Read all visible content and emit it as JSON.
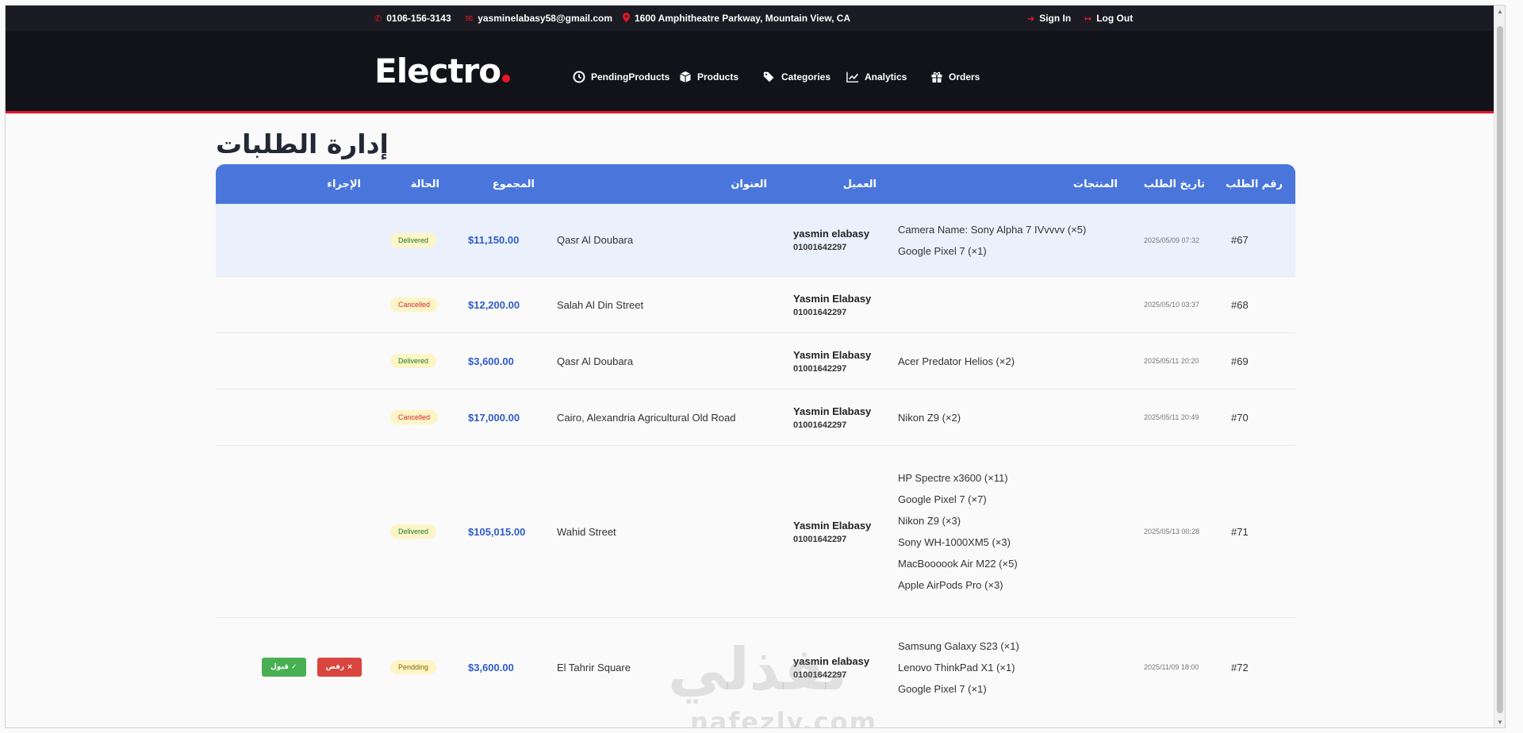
{
  "topbar": {
    "phone": "0106-156-3143",
    "email": "yasminelabasy58@gmail.com",
    "address": "1600 Amphitheatre Parkway, Mountain View, CA",
    "sign_in": "Sign In",
    "log_out": "Log Out"
  },
  "header": {
    "logo": "Electro",
    "nav": {
      "pending": "PendingProducts",
      "products": "Products",
      "categories": "Categories",
      "analytics": "Analytics",
      "orders": "Orders"
    }
  },
  "page": {
    "title": "إدارة الطلبات"
  },
  "table": {
    "headers": {
      "id": "رقم الطلب",
      "date": "تاريخ الطلب",
      "products": "المنتجات",
      "customer": "العميل",
      "address": "العنوان",
      "total": "المجموع",
      "status": "الحالة",
      "action": "الإجراء"
    },
    "rows": [
      {
        "id": "#67",
        "date": "2025/05/09 07:32",
        "products": [
          "Camera Name: Sony Alpha 7 IVvvvv (×5)",
          "Google Pixel 7 (×1)"
        ],
        "customer_name": "yasmin elabasy",
        "customer_phone": "01001642297",
        "address": "Qasr Al Doubara",
        "total": "$11,150.00",
        "status": "Delivered"
      },
      {
        "id": "#68",
        "date": "2025/05/10 03:37",
        "products": [],
        "customer_name": "Yasmin Elabasy",
        "customer_phone": "01001642297",
        "address": "Salah Al Din Street",
        "total": "$12,200.00",
        "status": "Cancelled"
      },
      {
        "id": "#69",
        "date": "2025/05/11 20:20",
        "products": [
          "Acer Predator Helios (×2)"
        ],
        "customer_name": "Yasmin Elabasy",
        "customer_phone": "01001642297",
        "address": "Qasr Al Doubara",
        "total": "$3,600.00",
        "status": "Delivered"
      },
      {
        "id": "#70",
        "date": "2025/05/11 20:49",
        "products": [
          "Nikon Z9 (×2)"
        ],
        "customer_name": "Yasmin Elabasy",
        "customer_phone": "01001642297",
        "address": "Cairo, Alexandria Agricultural Old Road",
        "total": "$17,000.00",
        "status": "Cancelled"
      },
      {
        "id": "#71",
        "date": "2025/05/13 00:28",
        "products": [
          "HP Spectre x3600 (×11)",
          "Google Pixel 7 (×7)",
          "Nikon Z9 (×3)",
          "Sony WH-1000XM5 (×3)",
          "MacBoooook Air M22 (×5)",
          "Apple AirPods Pro (×3)"
        ],
        "customer_name": "Yasmin Elabasy",
        "customer_phone": "01001642297",
        "address": "Wahid Street",
        "total": "$105,015.00",
        "status": "Delivered"
      },
      {
        "id": "#72",
        "date": "2025/11/09 18:00",
        "products": [
          "Samsung Galaxy S23 (×1)",
          "Lenovo ThinkPad X1 (×1)",
          "Google Pixel 7 (×1)"
        ],
        "customer_name": "yasmin elabasy",
        "customer_phone": "01001642297",
        "address": "El Tahrir Square",
        "total": "$3,600.00",
        "status": "Pendding",
        "actions": {
          "reject": "رفض ×",
          "accept": "قبول ✓"
        }
      }
    ]
  },
  "watermark": {
    "arabic": "نفذلي",
    "latin": "nafezly.com"
  },
  "icons": {
    "phone": "phone-icon",
    "email": "envelope-icon",
    "location": "map-marker-icon",
    "sign_in": "sign-in-icon",
    "log_out": "sign-out-icon",
    "pending": "clock-icon",
    "products": "box-icon",
    "categories": "tags-icon",
    "analytics": "chart-line-icon",
    "orders": "gift-box-icon"
  },
  "colors": {
    "accent": "#e8152b",
    "table_header": "#4a76dc",
    "total": "#2f5cc9",
    "accept": "#48b052",
    "reject": "#d9453f"
  }
}
